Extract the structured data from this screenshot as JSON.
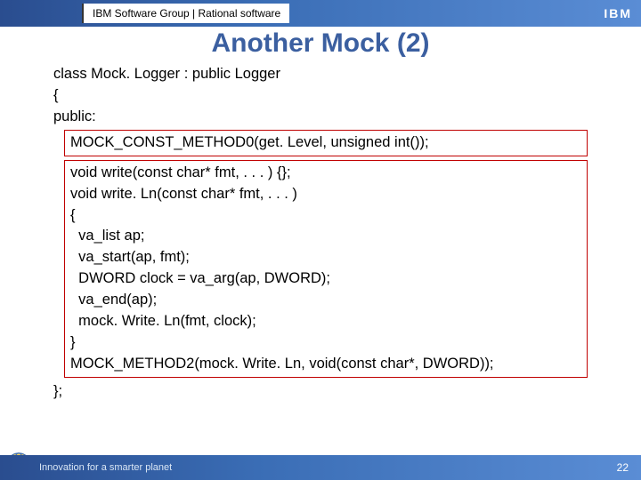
{
  "header": {
    "group_text": "IBM Software Group | Rational software",
    "logo_text": "IBM"
  },
  "title": "Another Mock (2)",
  "code": {
    "pre_lines": [
      "class Mock. Logger : public Logger",
      "{",
      "public:"
    ],
    "box1_lines": [
      "MOCK_CONST_METHOD0(get. Level, unsigned int());"
    ],
    "box2_lines": [
      "void write(const char* fmt, . . . ) {};",
      "void write. Ln(const char* fmt, . . . )",
      "{",
      "  va_list ap;",
      "  va_start(ap, fmt);",
      "  DWORD clock = va_arg(ap, DWORD);",
      "  va_end(ap);",
      "  mock. Write. Ln(fmt, clock);",
      "}",
      "MOCK_METHOD2(mock. Write. Ln, void(const char*, DWORD));"
    ],
    "post_lines": [
      "};"
    ]
  },
  "footer": {
    "tagline": "Innovation for a smarter planet",
    "page": "22"
  }
}
